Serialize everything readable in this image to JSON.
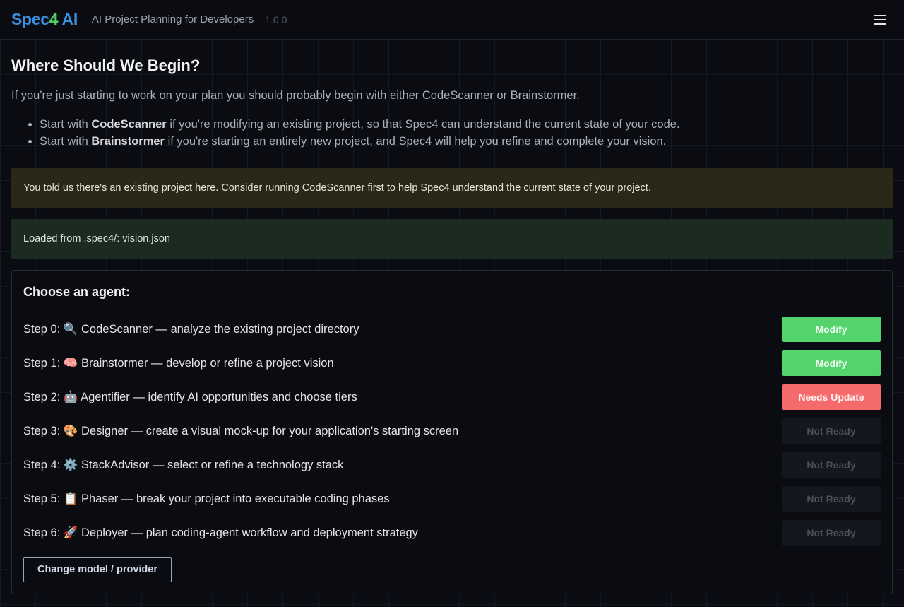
{
  "header": {
    "logo_part1": "Spec",
    "logo_part2": "4",
    "logo_part3": " AI",
    "tagline": "AI Project Planning for Developers",
    "version": "1.0.0",
    "menu_icon": "hamburger-icon"
  },
  "main": {
    "title": "Where Should We Begin?",
    "intro": "If you're just starting to work on your plan you should probably begin with either CodeScanner or Brainstormer.",
    "tips": [
      {
        "prefix": "Start with ",
        "bold": "CodeScanner",
        "suffix": " if you're modifying an existing project, so that Spec4 can understand the current state of your code."
      },
      {
        "prefix": "Start with ",
        "bold": "Brainstormer",
        "suffix": " if you're starting an entirely new project, and Spec4 will help you refine and complete your vision."
      }
    ],
    "warning_notice": "You told us there's an existing project here. Consider running CodeScanner first to help Spec4 understand the current state of your project.",
    "loaded_notice": "Loaded from .spec4/: vision.json"
  },
  "agents": {
    "heading": "Choose an agent:",
    "steps": [
      {
        "label": "Step 0: 🔍 CodeScanner — analyze the existing project directory",
        "button": "Modify",
        "status": "modify"
      },
      {
        "label": "Step 1: 🧠 Brainstormer — develop or refine a project vision",
        "button": "Modify",
        "status": "modify"
      },
      {
        "label": "Step 2: 🤖 Agentifier — identify AI opportunities and choose tiers",
        "button": "Needs Update",
        "status": "update"
      },
      {
        "label": "Step 3: 🎨 Designer — create a visual mock-up for your application's starting screen",
        "button": "Not Ready",
        "status": "notready"
      },
      {
        "label": "Step 4: ⚙️ StackAdvisor — select or refine a technology stack",
        "button": "Not Ready",
        "status": "notready"
      },
      {
        "label": "Step 5: 📋 Phaser — break your project into executable coding phases",
        "button": "Not Ready",
        "status": "notready"
      },
      {
        "label": "Step 6: 🚀 Deployer — plan coding-agent workflow and deployment strategy",
        "button": "Not Ready",
        "status": "notready"
      }
    ],
    "change_button": "Change model / provider"
  },
  "colors": {
    "background": "#0b0c12",
    "brand_blue": "#3b8fe0",
    "brand_green": "#52d36b",
    "modify": "#52d36b",
    "needs_update": "#f56a6a",
    "not_ready": "#15171e",
    "warning_bg": "#2b2818",
    "success_bg": "#1c2b22"
  }
}
